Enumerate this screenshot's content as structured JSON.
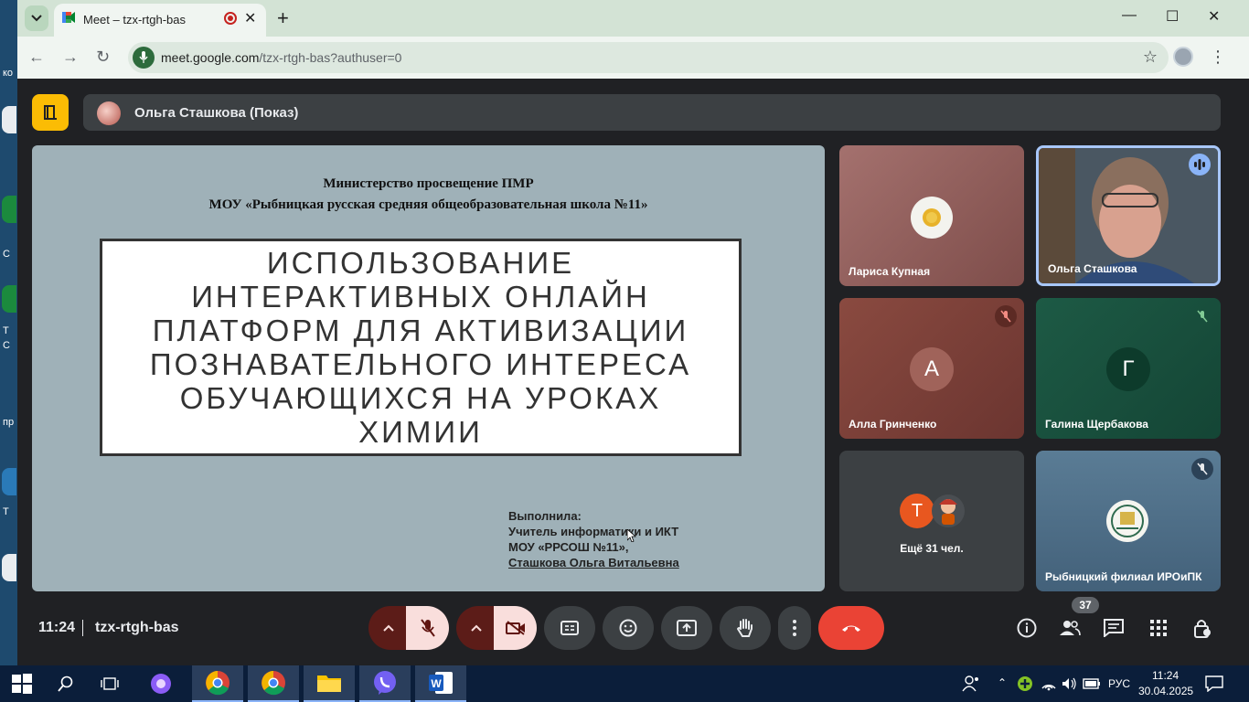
{
  "browser": {
    "tab_title": "Meet – tzx-rtgh-bas",
    "url_host": "meet.google.com",
    "url_path": "/tzx-rtgh-bas?authuser=0"
  },
  "presenter": {
    "label": "Ольга Сташкова (Показ)"
  },
  "slide": {
    "org_line1": "Министерство просвещение ПМР",
    "org_line2": "МОУ «Рыбницкая русская средняя общеобразовательная школа №11»",
    "title": "Использование интерактивных онлайн платформ для активизации познавательного интереса обучающихся на уроках химии",
    "credit_label": "Выполнила:",
    "credit_role": "Учитель информатики и ИКТ",
    "credit_school": "МОУ «РРСОШ №11»,",
    "credit_name": "Сташкова Ольга Витальевна"
  },
  "participants": [
    {
      "name": "Лариса Купная"
    },
    {
      "name": "Ольга Сташкова"
    },
    {
      "name": "Алла Гринченко",
      "initial": "А"
    },
    {
      "name": "Галина Щербакова",
      "initial": "Г"
    },
    {
      "name": "Ещё 31 чел.",
      "initial": "Т"
    },
    {
      "name": "Рыбницкий филиал ИРОиПК"
    }
  ],
  "meeting": {
    "time": "11:24",
    "code": "tzx-rtgh-bas",
    "people_count": "37"
  },
  "desktop": {
    "side_labels": [
      "ко",
      "С",
      "Т",
      "С",
      "пр",
      "Т"
    ]
  },
  "taskbar": {
    "lang": "РУС",
    "time": "11:24",
    "date": "30.04.2025"
  },
  "colors": {
    "accent_yellow": "#fbbc04",
    "end_call_red": "#ea4335",
    "muted_red": "#f9dedc"
  }
}
